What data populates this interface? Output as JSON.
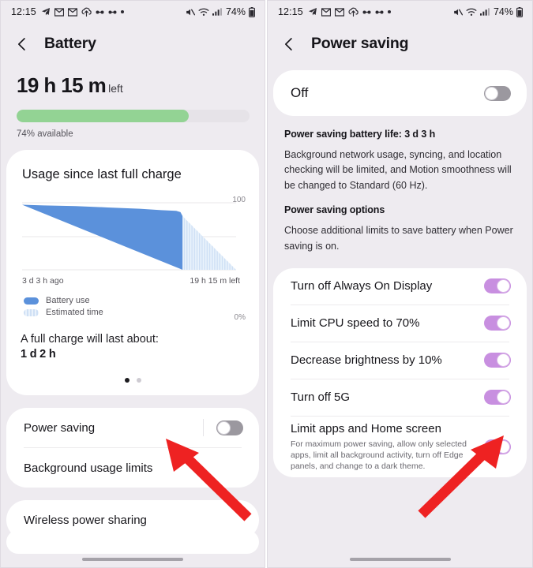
{
  "status_bar": {
    "time": "12:15",
    "battery_percent": "74%",
    "left_icons": [
      "telegram-send-icon",
      "mail-icon",
      "mail-icon",
      "cloud-sync-icon",
      "link-icon",
      "link-icon",
      "more-dot-icon"
    ],
    "right_icons": [
      "mute-icon",
      "wifi-icon",
      "signal-icon",
      "battery-icon"
    ]
  },
  "battery_screen": {
    "title": "Battery",
    "back_label": "Back",
    "time_remaining": "19 h 15 m",
    "time_remaining_suffix": "left",
    "battery_available_label": "74% available",
    "battery_percent_value": 74,
    "usage_card_title": "Usage since last full charge",
    "chart_x_start": "3 d 3 h ago",
    "chart_x_end": "19 h 15 m left",
    "chart_y_top": "100",
    "chart_y_bottom": "0%",
    "legend": [
      {
        "label": "Battery use",
        "key": "use"
      },
      {
        "label": "Estimated time",
        "key": "est"
      }
    ],
    "full_charge_label": "A full charge will last about:",
    "full_charge_value": "1 d 2 h",
    "pager": {
      "count": 2,
      "active": 0
    },
    "rows": [
      {
        "label": "Power saving",
        "toggle": "off"
      },
      {
        "label": "Background usage limits",
        "toggle": null
      }
    ],
    "rows2": [
      {
        "label": "Wireless power sharing",
        "toggle": null
      }
    ]
  },
  "power_saving_screen": {
    "title": "Power saving",
    "back_label": "Back",
    "master_label": "Off",
    "master_toggle": "off",
    "info": {
      "heading1": "Power saving battery life: 3 d 3 h",
      "paragraph1": "Background network usage, syncing, and location checking will be limited, and Motion smoothness will be changed to Standard (60 Hz).",
      "heading2": "Power saving options",
      "paragraph2": "Choose additional limits to save battery when Power saving is on."
    },
    "options": [
      {
        "label": "Turn off Always On Display",
        "sub": null,
        "toggle": "on"
      },
      {
        "label": "Limit CPU speed to 70%",
        "sub": null,
        "toggle": "on"
      },
      {
        "label": "Decrease brightness by 10%",
        "sub": null,
        "toggle": "on"
      },
      {
        "label": "Turn off 5G",
        "sub": null,
        "toggle": "on"
      },
      {
        "label": "Limit apps and Home screen",
        "sub": "For maximum power saving, allow only selected apps, limit all background activity, turn off Edge panels, and change to a dark theme.",
        "toggle": "on"
      }
    ]
  },
  "chart_data": {
    "type": "area",
    "title": "Usage since last full charge",
    "xlabel": "",
    "ylabel": "",
    "ylim": [
      0,
      100
    ],
    "xticks": [
      "3 d 3 h ago",
      "19 h 15 m left"
    ],
    "yticks": [
      "0%",
      "100"
    ],
    "grid": true,
    "legend_position": "below",
    "series": [
      {
        "name": "Battery use",
        "color": "#5b91db",
        "points": [
          [
            0,
            97
          ],
          [
            10,
            96
          ],
          [
            25,
            95
          ],
          [
            40,
            93
          ],
          [
            55,
            91
          ],
          [
            65,
            89
          ],
          [
            72,
            88
          ],
          [
            74,
            86
          ],
          [
            75,
            80
          ],
          [
            75,
            0
          ]
        ]
      },
      {
        "name": "Estimated time",
        "color": "#cfe0f5",
        "points": [
          [
            75,
            80
          ],
          [
            100,
            0
          ],
          [
            75,
            0
          ]
        ]
      }
    ]
  },
  "annotations": {
    "arrow_color": "#ee2222",
    "arrows": [
      {
        "name": "arrow-to-power-saving-row",
        "target": "power-saving-row"
      },
      {
        "name": "arrow-to-limit-apps-toggle",
        "target": "limit-apps-toggle"
      }
    ]
  },
  "colors": {
    "background": "#eeebf0",
    "card": "#ffffff",
    "battery_green": "#93d394",
    "toggle_on": "#c88fe0",
    "toggle_off": "#9b989f",
    "chart_blue": "#5b91db",
    "chart_blue_light": "#cfe0f5",
    "arrow_red": "#ee2222"
  }
}
